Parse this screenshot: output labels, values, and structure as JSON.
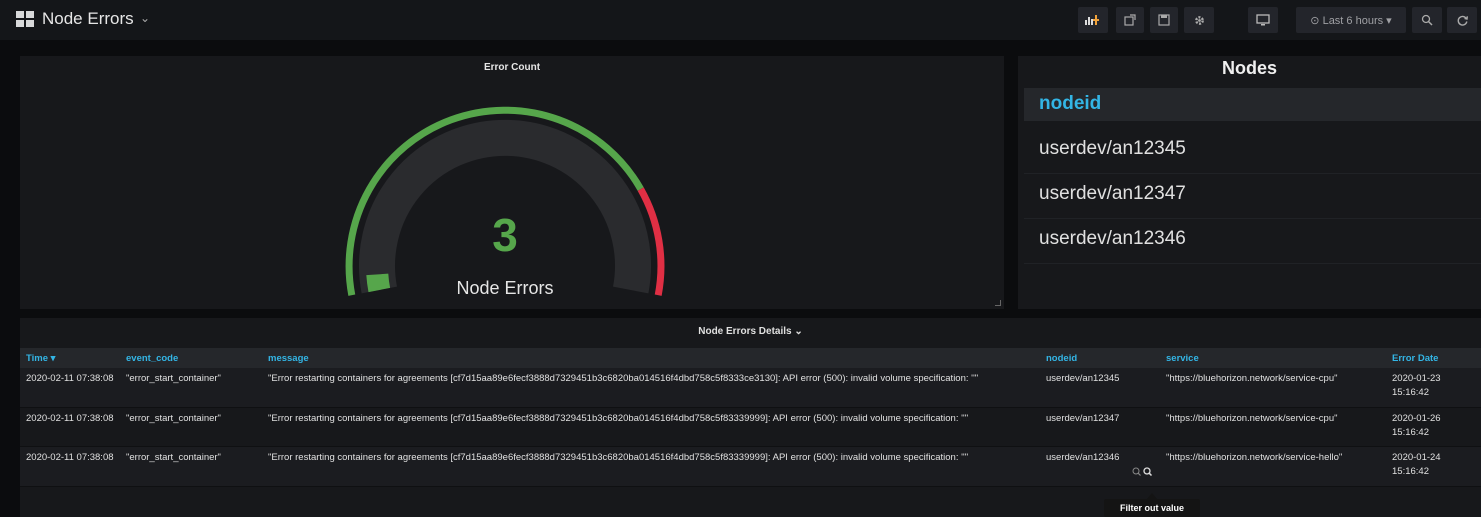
{
  "header": {
    "dashboard_icon": "dashboard-grid-icon",
    "title": "Node Errors",
    "title_caret": "⌄",
    "toolbar": {
      "add_panel_icon": "add-panel-icon",
      "share_icon": "share-icon",
      "save_icon": "save-icon",
      "settings_icon": "gear-icon",
      "tv_mode_icon": "monitor-icon",
      "time_range_label": "⊙ Last 6 hours ▾",
      "zoom_icon": "search-icon",
      "refresh_icon": "refresh-icon"
    }
  },
  "gauge": {
    "title": "Error Count",
    "value": "3",
    "label": "Node Errors",
    "min": 0,
    "max": 100,
    "current": 3,
    "threshold": 80,
    "colors": {
      "ok": "#56a64b",
      "warn": "#e02f44",
      "track": "#2a2b2e",
      "value": "#56a64b"
    }
  },
  "nodes": {
    "title": "Nodes",
    "header": "nodeid",
    "rows": [
      "userdev/an12345",
      "userdev/an12347",
      "userdev/an12346"
    ]
  },
  "details": {
    "title": "Node Errors Details ⌄",
    "columns": [
      "Time ▾",
      "event_code",
      "message",
      "nodeid",
      "service",
      "Error Date"
    ],
    "rows": [
      {
        "time": "2020-02-11 07:38:08",
        "event_code": "\"error_start_container\"",
        "message": "\"Error restarting containers for agreements [cf7d15aa89e6fecf3888d7329451b3c6820ba014516f4dbd758c5f8333ce3130]: API error (500): invalid volume specification: ''\"",
        "nodeid": "userdev/an12345",
        "service": "\"https://bluehorizon.network/service-cpu\"",
        "error_date": "2020-01-23 15:16:42"
      },
      {
        "time": "2020-02-11 07:38:08",
        "event_code": "\"error_start_container\"",
        "message": "\"Error restarting containers for agreements [cf7d15aa89e6fecf3888d7329451b3c6820ba014516f4dbd758c5f83339999]: API error (500): invalid volume specification: ''\"",
        "nodeid": "userdev/an12347",
        "service": "\"https://bluehorizon.network/service-cpu\"",
        "error_date": "2020-01-26 15:16:42"
      },
      {
        "time": "2020-02-11 07:38:08",
        "event_code": "\"error_start_container\"",
        "message": "\"Error restarting containers for agreements [cf7d15aa89e6fecf3888d7329451b3c6820ba014516f4dbd758c5f83339999]: API error (500): invalid volume specification: ''\"",
        "nodeid": "userdev/an12346",
        "service": "\"https://bluehorizon.network/service-hello\"",
        "error_date": "2020-01-24 15:16:42"
      }
    ],
    "row_actions": "⊕ 🔍",
    "tooltip": "Filter out value"
  }
}
